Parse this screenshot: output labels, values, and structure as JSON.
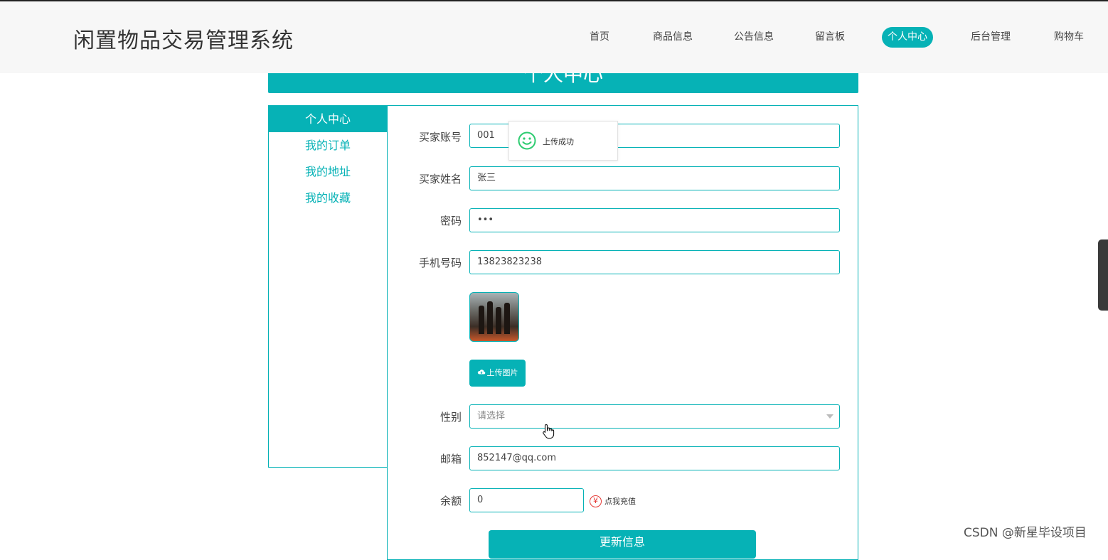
{
  "app": {
    "title": "闲置物品交易管理系统"
  },
  "nav": {
    "items": [
      {
        "label": "首页"
      },
      {
        "label": "商品信息"
      },
      {
        "label": "公告信息"
      },
      {
        "label": "留言板"
      },
      {
        "label": "个人中心",
        "active": true
      },
      {
        "label": "后台管理"
      },
      {
        "label": "购物车"
      }
    ]
  },
  "page": {
    "heading": "个人中心"
  },
  "sidebar": {
    "items": [
      {
        "label": "个人中心",
        "active": true
      },
      {
        "label": "我的订单"
      },
      {
        "label": "我的地址"
      },
      {
        "label": "我的收藏"
      }
    ]
  },
  "form": {
    "account": {
      "label": "买家账号",
      "value": "001"
    },
    "name": {
      "label": "买家姓名",
      "value": "张三"
    },
    "password": {
      "label": "密码",
      "value": "•••"
    },
    "phone": {
      "label": "手机号码",
      "value": "13823823238"
    },
    "upload_label": "上传图片",
    "gender": {
      "label": "性别",
      "placeholder": "请选择"
    },
    "email": {
      "label": "邮箱",
      "value": "852147@qq.com"
    },
    "balance": {
      "label": "余额",
      "value": "0",
      "recharge_icon": "¥",
      "recharge_label": "点我充值"
    },
    "submit_label": "更新信息"
  },
  "toast": {
    "message": "上传成功"
  },
  "watermark": "CSDN @新星毕设项目",
  "colors": {
    "accent": "#06b2b6",
    "toast_icon": "#2ecc71",
    "recharge": "#e53935"
  }
}
